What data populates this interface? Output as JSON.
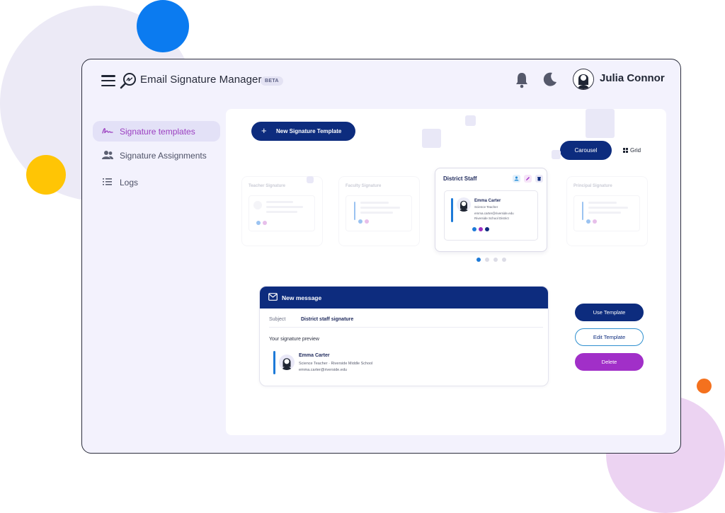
{
  "app": {
    "title": "Email Signature Manager",
    "badge": "BETA"
  },
  "user": {
    "name": "Julia Connor"
  },
  "sidebar": {
    "items": [
      {
        "label": "Signature templates",
        "active": true,
        "icon": "signature-icon"
      },
      {
        "label": "Signature Assignments",
        "active": false,
        "icon": "users-icon"
      },
      {
        "label": "Logs",
        "active": false,
        "icon": "list-icon"
      }
    ]
  },
  "toolbar": {
    "new_template_label": "New Signature Template",
    "carousel_label": "Carousel",
    "grid_label": "Grid"
  },
  "carousel": {
    "cards": [
      {
        "title": "Teacher Signature"
      },
      {
        "title": "Faculty Signature"
      },
      {
        "title": "District Staff",
        "name": "Emma Carter",
        "role": "Science Teacher",
        "email": "emma.carter@riverside.edu",
        "org": "Riverside School District"
      },
      {
        "title": "Principal Signature"
      }
    ],
    "pager": {
      "count": 4,
      "active": 0
    }
  },
  "message": {
    "header": "New message",
    "subject_label": "Subject",
    "subject_value": "District staff signature",
    "preview_label": "Your signature preview",
    "signature": {
      "name": "Emma Carter",
      "line1": "Science Teacher · Riverside Middle School",
      "line2": "emma.carter@riverside.edu"
    }
  },
  "actions": {
    "use_label": "Use Template",
    "edit_label": "Edit Template",
    "delete_label": "Delete"
  },
  "colors": {
    "navy": "#0d2c7e",
    "purple": "#a12fc8",
    "blue": "#1d7ad8",
    "dot_blue": "#4b93e6",
    "dot_pink": "#d58bd9",
    "dot_purple": "#9b2fc0"
  }
}
